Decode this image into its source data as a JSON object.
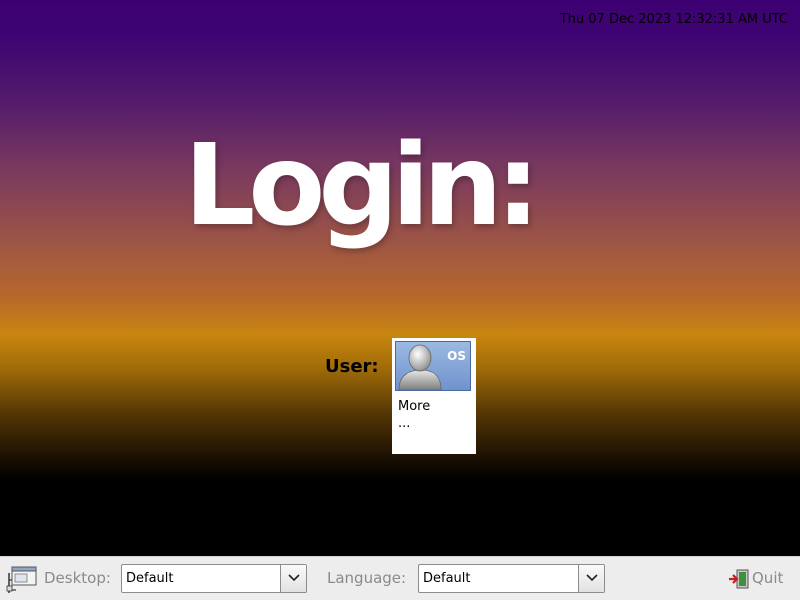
{
  "clock": {
    "text": "Thu 07 Dec 2023 12:32:31 AM UTC"
  },
  "greeting": {
    "title": "Login:"
  },
  "user_chooser": {
    "label": "User:",
    "users": [
      {
        "badge": "OS",
        "name": "More ...",
        "icon": "person-silhouette-icon"
      }
    ]
  },
  "bottom_bar": {
    "desktop": {
      "icon": "desktop-session-icon",
      "label": "Desktop:",
      "selected": "Default"
    },
    "language": {
      "label": "Language:",
      "selected": "Default"
    },
    "quit": {
      "icon": "exit-door-icon",
      "label": "Quit"
    }
  },
  "colors": {
    "gradient_top": "#3d0072",
    "gradient_mid": "#c8860f",
    "gradient_bottom": "#000000",
    "bar_background": "#ededed",
    "bar_text": "#8a8a8a"
  }
}
